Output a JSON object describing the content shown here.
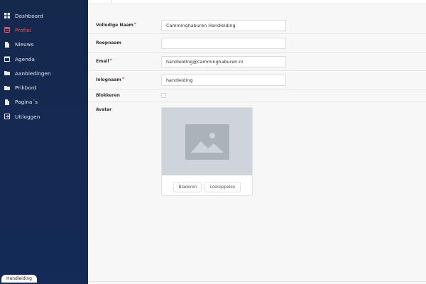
{
  "sidebar": {
    "items": [
      {
        "label": "Dashboard",
        "icon": "dashboard-icon"
      },
      {
        "label": "Profiel",
        "icon": "profile-icon",
        "active": true
      },
      {
        "label": "Nieuws",
        "icon": "news-icon"
      },
      {
        "label": "Agenda",
        "icon": "calendar-icon"
      },
      {
        "label": "Aanbiedingen",
        "icon": "folder-icon"
      },
      {
        "label": "Prikbord",
        "icon": "board-icon"
      },
      {
        "label": "Pagina´s",
        "icon": "pages-icon"
      },
      {
        "label": "Uitloggen",
        "icon": "logout-icon"
      }
    ],
    "footer_label": "Handleiding"
  },
  "form": {
    "full_name": {
      "label": "Volledige Naam",
      "required": "*",
      "value": "Camminghaburen Handleiding"
    },
    "nickname": {
      "label": "Roepnaam",
      "value": ""
    },
    "email": {
      "label": "Email",
      "required": "*",
      "value": "handleiding@camminghaburen.nl"
    },
    "username": {
      "label": "Inlognaam",
      "required": "*",
      "value": "handleiding"
    },
    "blocked": {
      "label": "Blokkeren",
      "checked": false
    },
    "avatar": {
      "label": "Avatar",
      "browse_label": "Bladeren",
      "unlink_label": "Loskoppelen"
    }
  },
  "colors": {
    "sidebar_bg": "#15294d",
    "active": "#e8566a",
    "required": "#e23c3c",
    "placeholder_bg": "#ced4da"
  }
}
